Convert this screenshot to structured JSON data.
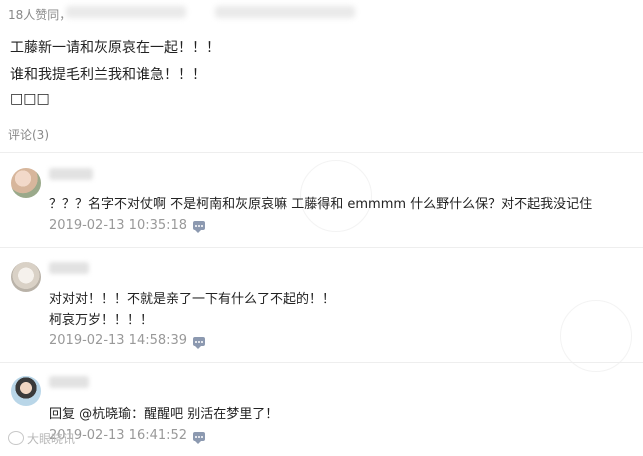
{
  "post": {
    "likes_text": "18人赞同，",
    "lines": [
      "工藤新一请和灰原哀在一起！！！",
      "谁和我提毛利兰我和谁急！！！",
      "□□□"
    ]
  },
  "comments_header": "评论(3)",
  "comments": [
    {
      "text_lines": [
        "？？？名字不对仗啊 不是柯南和灰原哀嘛 工藤得和 emmmm 什么野什么保？对不起我没记住"
      ],
      "timestamp": "2019-02-13 10:35:18",
      "reply_icon": "comment-bubble-icon"
    },
    {
      "text_lines": [
        "对对对！！！不就是亲了一下有什么了不起的！！",
        "柯哀万岁！！！！"
      ],
      "timestamp": "2019-02-13 14:58:39",
      "reply_icon": "comment-bubble-icon"
    },
    {
      "text_lines": [
        "回复 @杭晓瑜：醒醒吧 别活在梦里了！"
      ],
      "timestamp": "2019-02-13 16:41:52",
      "reply_icon": "comment-bubble-icon"
    }
  ],
  "watermark": "大眼晓讯",
  "colors": {
    "muted_text": "#888888",
    "timestamp": "#999999",
    "body_text": "#222222",
    "reply_icon": "#8c99b0"
  }
}
